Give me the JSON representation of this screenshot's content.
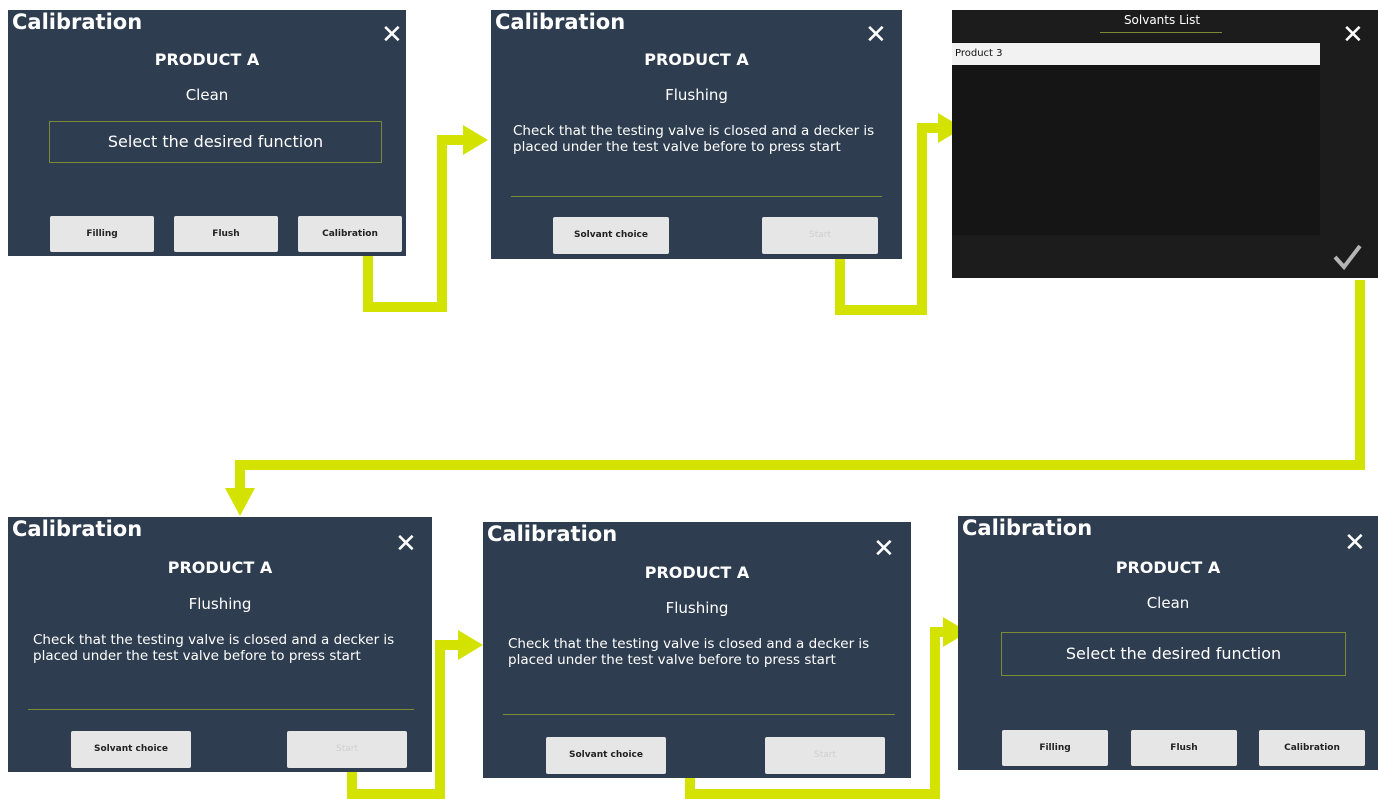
{
  "colors": {
    "panel_bg": "#2e3d4f",
    "accent": "#7a8a35",
    "arrow": "#d4e200",
    "dark_bg": "#1c1c1c"
  },
  "screen1": {
    "title": "Calibration",
    "close": "✕",
    "product": "PRODUCT A",
    "subtitle": "Clean",
    "prompt": "Select the desired function",
    "buttons": {
      "filling": "Filling",
      "flush": "Flush",
      "calibration": "Calibration"
    }
  },
  "screen2": {
    "title": "Calibration",
    "close": "✕",
    "product": "PRODUCT A",
    "subtitle": "Flushing",
    "message": "Check that the testing valve is closed and a decker is placed under the test valve before to press start",
    "buttons": {
      "solvant": "Solvant choice",
      "start": "Start"
    }
  },
  "screen3": {
    "title": "Solvants List",
    "close": "✕",
    "items": [
      "Product 3"
    ],
    "confirm_icon": "checkmark-icon"
  },
  "screen4": {
    "title": "Calibration",
    "close": "✕",
    "product": "PRODUCT A",
    "subtitle": "Flushing",
    "message": "Check that the testing valve is closed and a decker is placed under the test valve before to press start",
    "buttons": {
      "solvant": "Solvant choice",
      "start": "Start"
    }
  },
  "screen5": {
    "title": "Calibration",
    "close": "✕",
    "product": "PRODUCT A",
    "subtitle": "Flushing",
    "message": "Check that the testing valve is closed and a decker is placed under the test valve before to press start",
    "buttons": {
      "solvant": "Solvant choice",
      "start": "Start"
    }
  },
  "screen6": {
    "title": "Calibration",
    "close": "✕",
    "product": "PRODUCT A",
    "subtitle": "Clean",
    "prompt": "Select the desired function",
    "buttons": {
      "filling": "Filling",
      "flush": "Flush",
      "calibration": "Calibration"
    }
  }
}
